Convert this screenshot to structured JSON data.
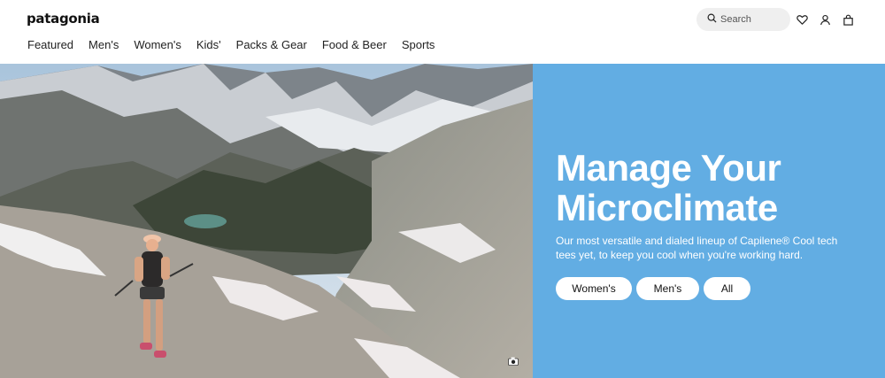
{
  "brand": {
    "logo": "patagonia"
  },
  "nav": {
    "items": [
      {
        "label": "Featured"
      },
      {
        "label": "Men's"
      },
      {
        "label": "Women's"
      },
      {
        "label": "Kids'"
      },
      {
        "label": "Packs & Gear"
      },
      {
        "label": "Food & Beer"
      },
      {
        "label": "Sports"
      }
    ]
  },
  "search": {
    "placeholder": "Search"
  },
  "icons": {
    "search": "search-icon",
    "wishlist": "heart-icon",
    "account": "user-icon",
    "cart": "bag-icon",
    "photo": "camera-icon"
  },
  "hero": {
    "headline": "Manage Your Microclimate",
    "subtext": "Our most versatile and dialed lineup of Capilene® Cool tech tees yet, to keep you cool when you're working hard.",
    "buttons": [
      {
        "label": "Women's"
      },
      {
        "label": "Men's"
      },
      {
        "label": "All"
      }
    ]
  },
  "colors": {
    "panel": "#62ade3",
    "search_bg": "#efefef"
  }
}
